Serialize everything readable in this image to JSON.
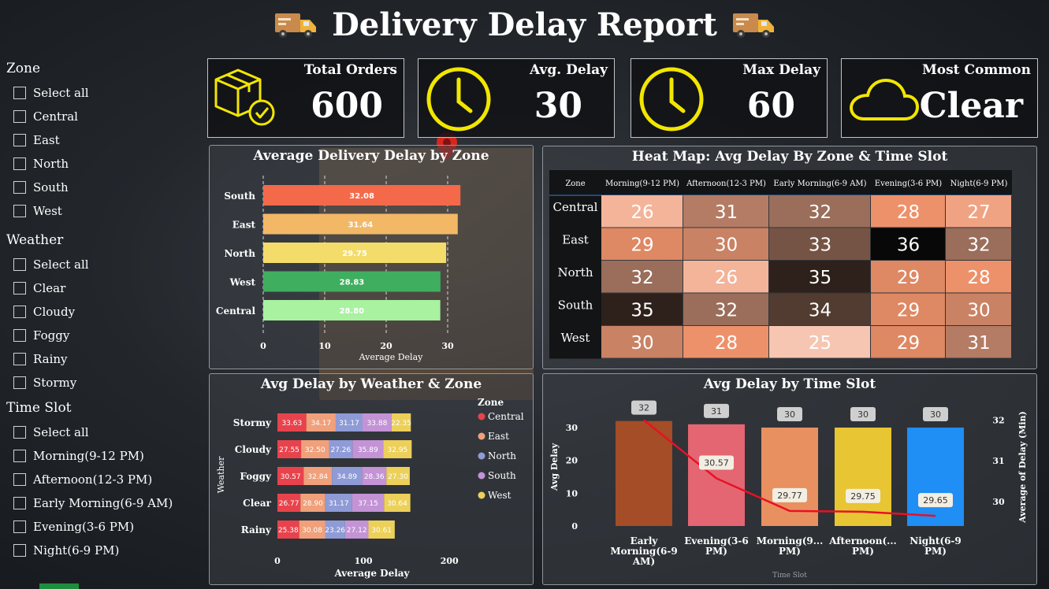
{
  "header": {
    "title": "Delivery Delay Report",
    "icon_left": "delivery-truck-icon",
    "icon_right": "delivery-truck-icon"
  },
  "slicers": {
    "zone": {
      "label": "Zone",
      "items": [
        "Select all",
        "Central",
        "East",
        "North",
        "South",
        "West"
      ]
    },
    "weather": {
      "label": "Weather",
      "items": [
        "Select all",
        "Clear",
        "Cloudy",
        "Foggy",
        "Rainy",
        "Stormy"
      ]
    },
    "time_slot": {
      "label": "Time Slot",
      "items": [
        "Select all",
        "Morning(9-12 PM)",
        "Afternoon(12-3 PM)",
        "Early Morning(6-9 AM)",
        "Evening(3-6 PM)",
        "Night(6-9 PM)"
      ]
    }
  },
  "kpis": {
    "total_orders": {
      "label": "Total Orders",
      "value": "600",
      "icon": "package-check-icon"
    },
    "avg_delay": {
      "label": "Avg. Delay",
      "value": "30",
      "icon": "clock-icon"
    },
    "max_delay": {
      "label": "Max Delay",
      "value": "60",
      "icon": "clock-icon"
    },
    "most_common": {
      "label": "Most Common",
      "value": "Clear",
      "icon": "cloud-icon"
    }
  },
  "colors": {
    "kpi_icon": "#f2e600",
    "zone_bars": [
      "#f4694a",
      "#f2b866",
      "#f3dc6a",
      "#3fae5f",
      "#a8f2a0"
    ],
    "weather_zone": {
      "Central": "#e8434d",
      "East": "#f0a07a",
      "North": "#8f9bd6",
      "South": "#c393d6",
      "West": "#ecd05a"
    },
    "time_slot_bars": [
      "#a44d26",
      "#e46672",
      "#e99060",
      "#e8c532",
      "#1f8ef5"
    ],
    "line": "#e81123"
  },
  "chart_data": [
    {
      "type": "bar",
      "title": "Average Delivery Delay by Zone",
      "categories": [
        "South",
        "East",
        "North",
        "West",
        "Central"
      ],
      "values": [
        32.08,
        31.64,
        29.75,
        28.83,
        28.8
      ],
      "data_labels": [
        "32.08",
        "31.64",
        "29.75",
        "28.83",
        "28.80"
      ],
      "xlabel": "Average Delay",
      "ylabel": "",
      "xlim": [
        0,
        35
      ],
      "x_ticks": [
        "0",
        "10",
        "20",
        "30"
      ],
      "orientation": "horizontal",
      "grid": "vertical dashed"
    },
    {
      "type": "heatmap",
      "title": "Heat Map: Avg Delay By Zone & Time Slot",
      "corner_label": "Zone",
      "columns": [
        "Morning(9-12 PM)",
        "Afternoon(12-3 PM)",
        "Early Morning(6-9 AM)",
        "Evening(3-6 PM)",
        "Night(6-9 PM)"
      ],
      "rows": [
        "Central",
        "East",
        "North",
        "South",
        "West"
      ],
      "values": [
        [
          26,
          31,
          32,
          28,
          27
        ],
        [
          29,
          30,
          33,
          36,
          32
        ],
        [
          32,
          26,
          35,
          29,
          28
        ],
        [
          35,
          32,
          34,
          29,
          30
        ],
        [
          30,
          28,
          25,
          29,
          31
        ]
      ]
    },
    {
      "type": "bar",
      "stacked": true,
      "orientation": "horizontal",
      "title": "Avg Delay by Weather & Zone",
      "categories": [
        "Stormy",
        "Cloudy",
        "Foggy",
        "Clear",
        "Rainy"
      ],
      "legend_title": "Zone",
      "series": [
        {
          "name": "Central",
          "values": [
            33.63,
            27.55,
            30.57,
            26.77,
            25.38
          ],
          "labels": [
            "33.63",
            "27.55",
            "30.57",
            "26.77",
            "25.38"
          ]
        },
        {
          "name": "East",
          "values": [
            34.17,
            32.5,
            32.84,
            28.9,
            30.08
          ],
          "labels": [
            "34.17",
            "32.50",
            "32.84",
            "28.90",
            "30.08"
          ]
        },
        {
          "name": "North",
          "values": [
            31.17,
            27.26,
            34.89,
            31.17,
            23.26
          ],
          "labels": [
            "31.17",
            "27.26",
            "34.89",
            "31.17",
            "23.26"
          ]
        },
        {
          "name": "South",
          "values": [
            33.88,
            35.89,
            28.36,
            37.15,
            27.12
          ],
          "labels": [
            "33.88",
            "35.89",
            "28.36",
            "37.15",
            "27.12"
          ]
        },
        {
          "name": "West",
          "values": [
            22.35,
            32.95,
            27.3,
            30.64,
            30.61
          ],
          "labels": [
            "22.35",
            "32.95",
            "27.30",
            "30.64",
            "30.61"
          ]
        }
      ],
      "xlabel": "Average Delay",
      "ylabel": "Weather",
      "xlim": [
        0,
        220
      ],
      "x_ticks": [
        "0",
        "100",
        "200"
      ],
      "legend_position": "right"
    },
    {
      "type": "bar",
      "title": "Avg Delay by Time Slot",
      "categories": [
        "Early Morning(6-9 AM)",
        "Evening(3-6 PM)",
        "Morning(9...PM)",
        "Afternoon(... PM)",
        "Night(6-9 PM)"
      ],
      "category_labels": [
        [
          "Early",
          "Morning(6-9",
          "AM)"
        ],
        [
          "Evening(3-6",
          "PM)"
        ],
        [
          "Morning(9...",
          "PM)"
        ],
        [
          "Afternoon(...",
          "PM)"
        ],
        [
          "Night(6-9",
          "PM)"
        ]
      ],
      "bar_values": [
        32,
        31,
        30,
        30,
        30
      ],
      "bar_labels": [
        "32",
        "31",
        "30",
        "30",
        "30"
      ],
      "line_values": [
        32.0,
        30.57,
        29.77,
        29.75,
        29.65
      ],
      "line_labels": [
        "",
        "30.57",
        "29.77",
        "29.75",
        "29.65"
      ],
      "ylabel": "Avg Delay",
      "ylim": [
        0,
        36
      ],
      "y_ticks": [
        "0",
        "10",
        "20",
        "30"
      ],
      "y2label": "Average of Delay (Min)",
      "y2lim": [
        29.4,
        32.3
      ],
      "y2_ticks": [
        "30",
        "31",
        "32"
      ],
      "xlabel": "Time Slot"
    }
  ]
}
